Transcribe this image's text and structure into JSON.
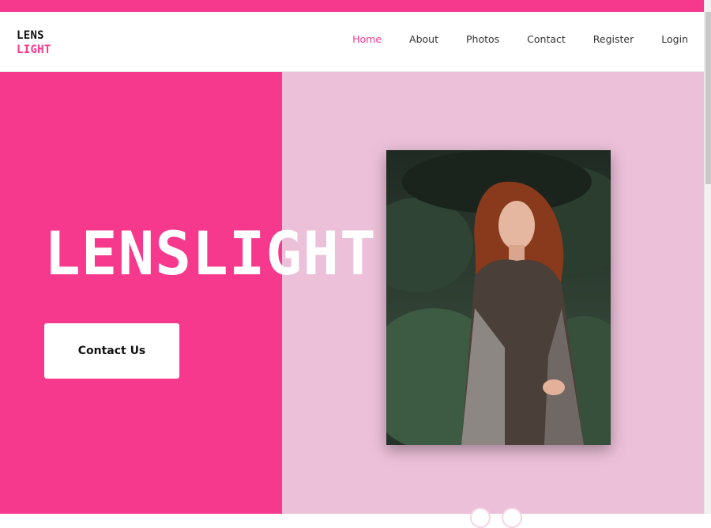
{
  "logo": {
    "line1": "LENS",
    "line2": "LIGHT"
  },
  "nav": {
    "items": [
      "Home",
      "About",
      "Photos",
      "Contact",
      "Register",
      "Login"
    ],
    "active": "Home"
  },
  "hero": {
    "title": "LENSLIGHT",
    "button_label": "Contact Us"
  },
  "colors": {
    "brand": "#f7398e",
    "hero_right_bg": "#ecc0d9",
    "white": "#ffffff"
  },
  "icons": {
    "photo": "portrait-photo-of-red-haired-woman",
    "carousel": "slider-dot-icon"
  }
}
